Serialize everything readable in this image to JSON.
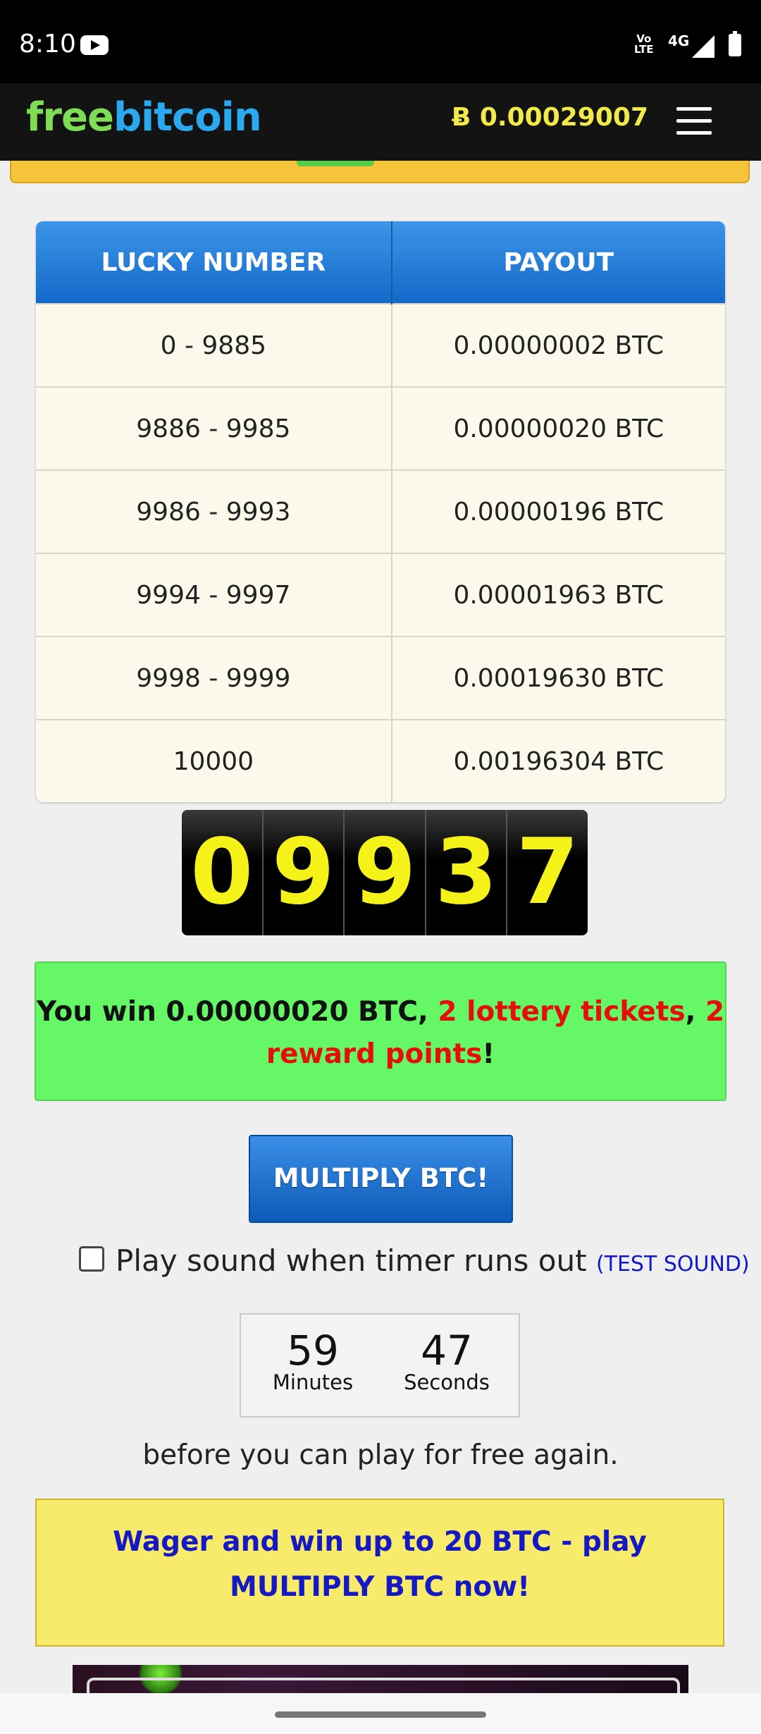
{
  "status_bar": {
    "time": "8:10",
    "volte": "Vo\nLTE",
    "network": "4G"
  },
  "navbar": {
    "logo_free": "free",
    "logo_bitcoin": "bitcoin",
    "balance": "Ƀ 0.00029007"
  },
  "payout_table": {
    "headers": [
      "LUCKY NUMBER",
      "PAYOUT"
    ],
    "rows": [
      [
        "0 - 9885",
        "0.00000002 BTC"
      ],
      [
        "9886 - 9985",
        "0.00000020 BTC"
      ],
      [
        "9986 - 9993",
        "0.00000196 BTC"
      ],
      [
        "9994 - 9997",
        "0.00001963 BTC"
      ],
      [
        "9998 - 9999",
        "0.00019630 BTC"
      ],
      [
        "10000",
        "0.00196304 BTC"
      ]
    ]
  },
  "roll_result": {
    "digits": [
      "0",
      "9",
      "9",
      "3",
      "7"
    ]
  },
  "win_message": {
    "prefix": "You win 0.00000020 BTC, ",
    "tickets": "2 lottery tickets",
    "sep": ", ",
    "points": "2 reward points",
    "suffix": "!"
  },
  "multiply_button": "MULTIPLY BTC!",
  "sound_option": {
    "label": "Play sound when timer runs out",
    "open_paren": "(",
    "test_link": "TEST SOUND",
    "close_paren": ")",
    "checked": false
  },
  "timer": {
    "minutes": "59",
    "minutes_label": "Minutes",
    "seconds": "47",
    "seconds_label": "Seconds"
  },
  "again_text": "before you can play for free again.",
  "wager_banner": "Wager and win up to 20 BTC - play MULTIPLY BTC now!",
  "colors": {
    "table_header": "#1f7ad6",
    "win_box": "#66f766",
    "win_highlight": "#e60d0d",
    "wager_box": "#f8ea6a",
    "wager_text": "#1419c4",
    "roll_digit": "#f5f21a"
  }
}
